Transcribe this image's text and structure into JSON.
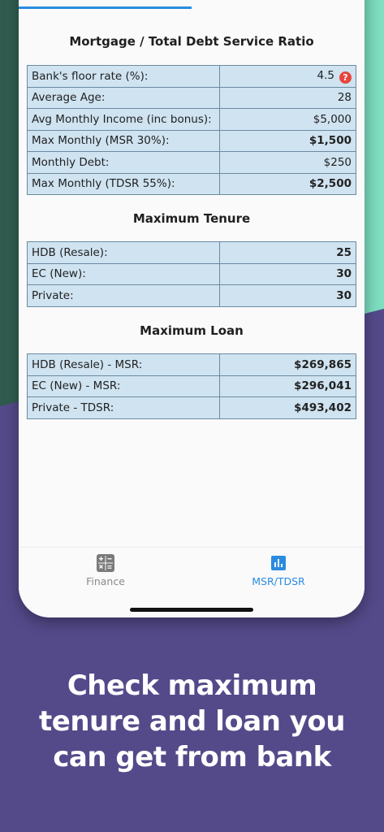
{
  "mortgage": {
    "title": "Mortgage / Total Debt Service Ratio",
    "rows": [
      {
        "label": "Bank's floor rate (%):",
        "value": "4.5"
      },
      {
        "label": "Average Age:",
        "value": "28"
      },
      {
        "label": "Avg Monthly Income (inc bonus):",
        "value": "$5,000"
      },
      {
        "label": "Max Monthly (MSR 30%):",
        "value": "$1,500"
      },
      {
        "label": "Monthly Debt:",
        "value": "$250"
      },
      {
        "label": "Max Monthly (TDSR 55%):",
        "value": "$2,500"
      }
    ],
    "help_symbol": "?"
  },
  "tenure": {
    "title": "Maximum Tenure",
    "rows": [
      {
        "label": "HDB (Resale):",
        "value": "25"
      },
      {
        "label": "EC (New):",
        "value": "30"
      },
      {
        "label": "Private:",
        "value": "30"
      }
    ]
  },
  "loan": {
    "title": "Maximum Loan",
    "rows": [
      {
        "label": "HDB (Resale) - MSR:",
        "value": "$269,865"
      },
      {
        "label": "EC (New) - MSR:",
        "value": "$296,041"
      },
      {
        "label": "Private - TDSR:",
        "value": "$493,402"
      }
    ]
  },
  "nav": {
    "finance": {
      "label": "Finance",
      "icon": "calculator-icon",
      "color": "#8a8a8a"
    },
    "msr": {
      "label": "MSR/TDSR",
      "icon": "bar-chart-icon",
      "color": "#2a8be0",
      "active": true
    }
  },
  "caption": {
    "line1": "Check maximum",
    "line2": "tenure and loan you",
    "line3": "can get from bank"
  },
  "colors": {
    "accent": "#2a8be0",
    "table_bg": "#cfe3f1",
    "background_purple": "#544a8a",
    "help_red": "#e8453c"
  }
}
